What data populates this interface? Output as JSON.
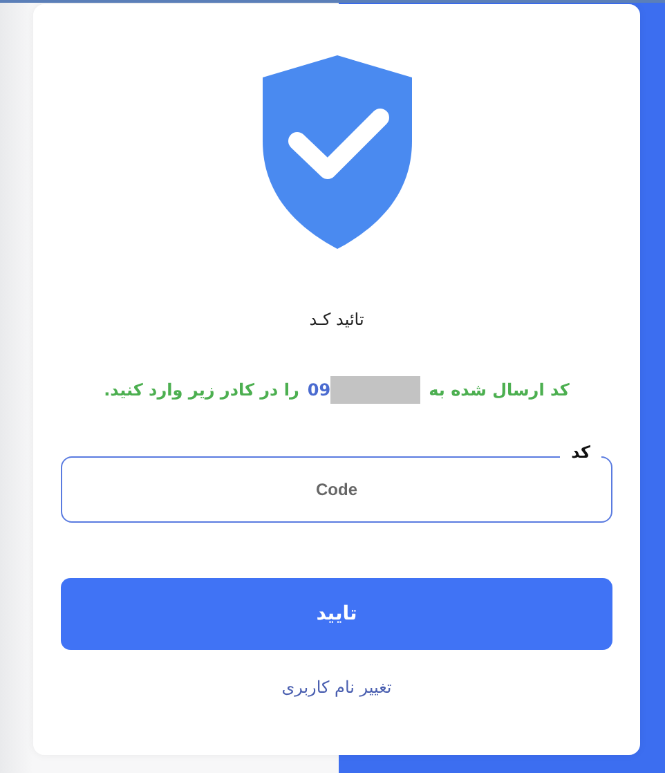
{
  "title": "تائید کـد",
  "message": {
    "prefix": "کد ارسال شده به",
    "phone": "09",
    "suffix": "را در کادر زیر وارد کنید.",
    "redacted": true
  },
  "code_field": {
    "label": "کد",
    "placeholder": "Code",
    "focused": true
  },
  "submit_button": "تایید",
  "change_username_link": "تغییر نام کاربری"
}
